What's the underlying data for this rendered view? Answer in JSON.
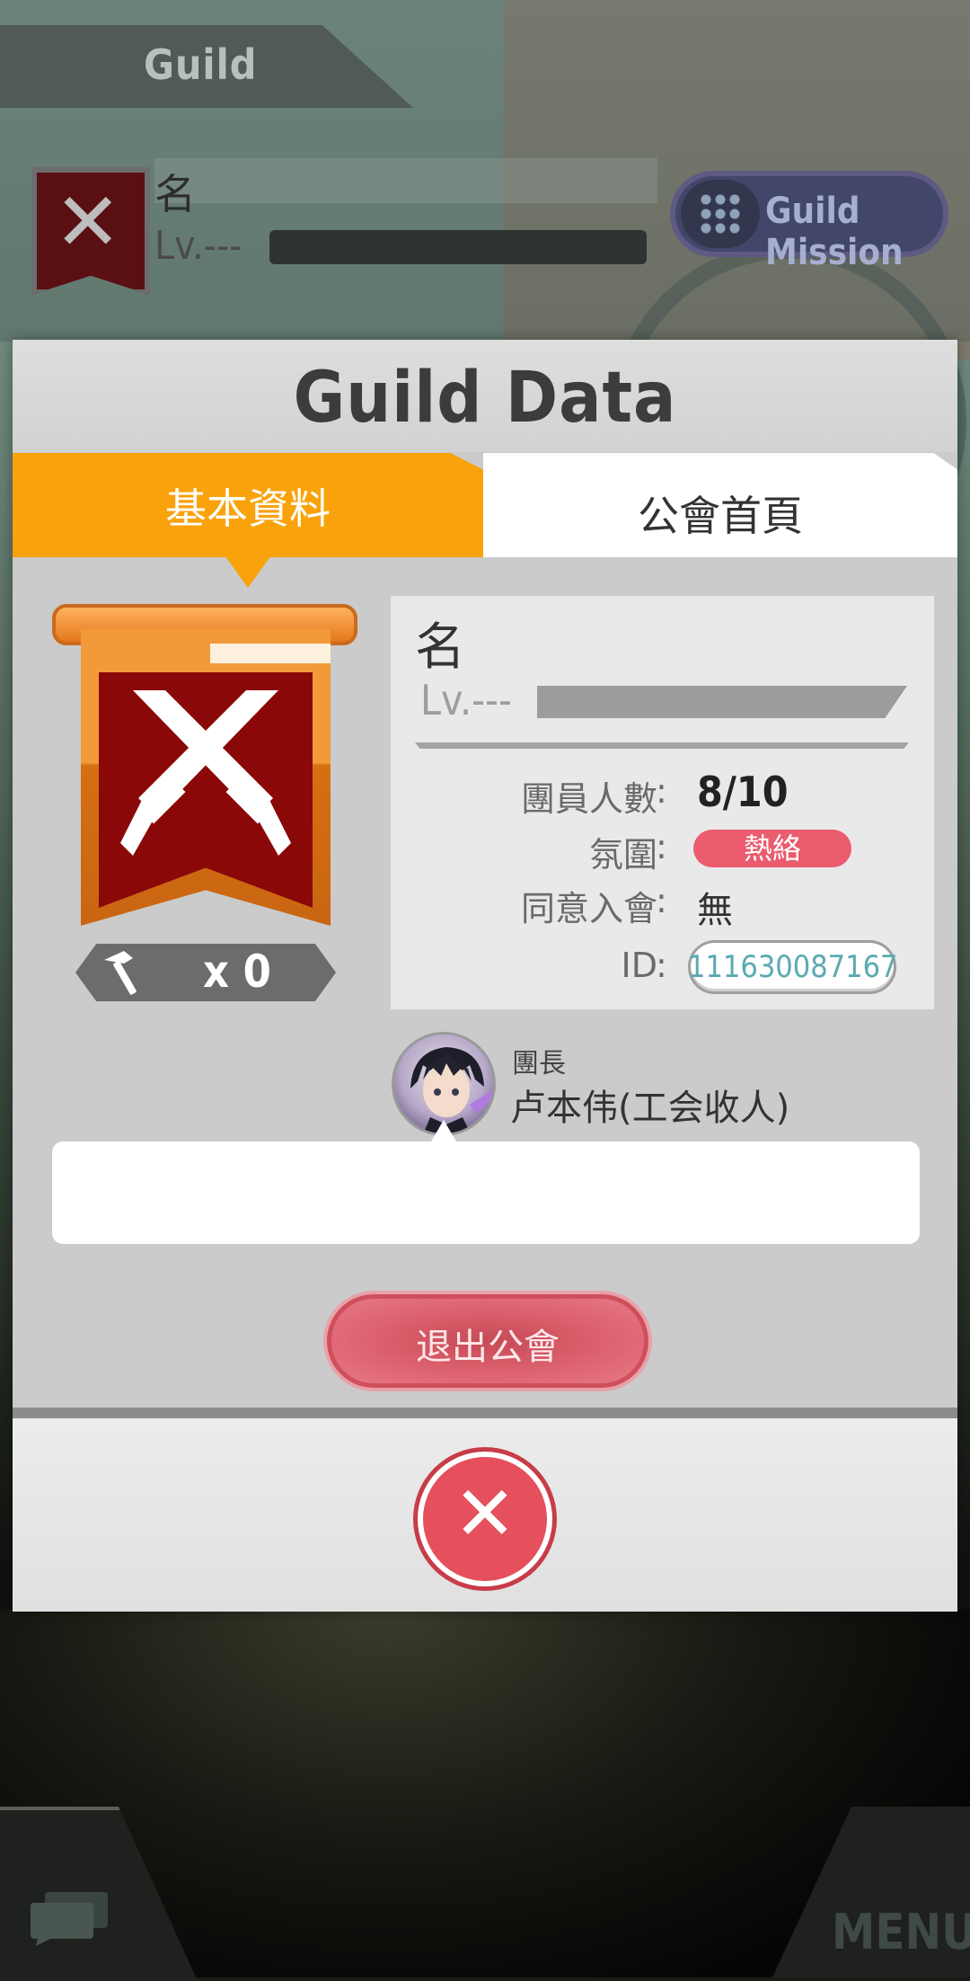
{
  "background": {
    "screen_title": "Guild",
    "guild_name": "名",
    "level": "Lv.---",
    "mission_button": "Guild Mission",
    "menu_button": "MENU",
    "chat_icon": "chat-icon"
  },
  "dialog": {
    "title": "Guild Data",
    "tabs": [
      {
        "label": "基本資料",
        "active": true
      },
      {
        "label": "公會首頁",
        "active": false
      }
    ],
    "emblem": {
      "icon": "crossed-swords-icon",
      "banner_color": "#8b0808",
      "frame_color": "#f29a3a"
    },
    "hammer_count": "x 0",
    "guild_name": "名",
    "level": "Lv.---",
    "rows": [
      {
        "label": "團員人數",
        "colon": ":",
        "value": "8/10"
      },
      {
        "label": "氛圍",
        "colon": ":",
        "value": "熱絡"
      },
      {
        "label": "同意入會",
        "colon": ":",
        "value": "無"
      },
      {
        "label": "ID",
        "colon": ":",
        "value": "111630087167"
      }
    ],
    "leader": {
      "role": "團長",
      "name": "卢本伟(工会收人)"
    },
    "message": "",
    "leave_button": "退出公會",
    "close_icon": "close-icon"
  },
  "colors": {
    "accent_orange": "#f9a20b",
    "badge_red": "#ea5c6e",
    "button_red": "#e64f5c",
    "id_teal": "#5aaab0"
  }
}
